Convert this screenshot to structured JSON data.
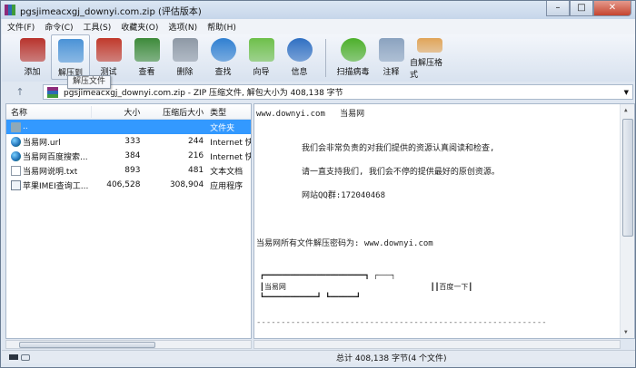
{
  "title": "pgsjimeacxgj_downyi.com.zip (评估版本)",
  "window_buttons": {
    "minimize": "–",
    "maximize": "□",
    "close": "✕"
  },
  "menu": [
    "文件(F)",
    "命令(C)",
    "工具(S)",
    "收藏夹(O)",
    "选项(N)",
    "帮助(H)"
  ],
  "toolbar": [
    {
      "label": "添加",
      "icon": "add-archive-icon",
      "color": "#b8332c"
    },
    {
      "label": "解压到",
      "icon": "extract-folder-icon",
      "color": "#4a92d6"
    },
    {
      "label": "测试",
      "icon": "test-checklist-icon",
      "color": "#c0392b"
    },
    {
      "label": "查看",
      "icon": "view-book-icon",
      "color": "#3d8a3a"
    },
    {
      "label": "删除",
      "icon": "trash-icon",
      "color": "#8d98a5"
    },
    {
      "label": "查找",
      "icon": "find-magnifier-icon",
      "color": "#2f7fd1"
    },
    {
      "label": "向导",
      "icon": "wizard-wand-icon",
      "color": "#6dbf4a"
    },
    {
      "label": "信息",
      "icon": "info-icon",
      "color": "#2f6fc2"
    },
    {
      "label": "扫描病毒",
      "icon": "virus-scan-icon",
      "color": "#4caf2a"
    },
    {
      "label": "注释",
      "icon": "comment-icon",
      "color": "#8aa2bf"
    },
    {
      "label": "自解压格式",
      "icon": "sfx-box-icon",
      "color": "#e0a458"
    }
  ],
  "tooltip": "解压文件",
  "address": {
    "text": "pgsjimeacxgj_downyi.com.zip - ZIP 压缩文件, 解包大小为 408,138 字节",
    "up": "↑"
  },
  "columns": [
    "名称",
    "大小",
    "压缩后大小",
    "类型"
  ],
  "files": [
    {
      "name": "..",
      "size": "",
      "packed": "",
      "type": "文件夹",
      "icon": "folder"
    },
    {
      "name": "当易网.url",
      "size": "333",
      "packed": "244",
      "type": "Internet 快",
      "icon": "globe"
    },
    {
      "name": "当易网百度搜索...",
      "size": "384",
      "packed": "216",
      "type": "Internet 快",
      "icon": "globe"
    },
    {
      "name": "当易网说明.txt",
      "size": "893",
      "packed": "481",
      "type": "文本文档",
      "icon": "txt"
    },
    {
      "name": "苹果IMEI查询工...",
      "size": "406,528",
      "packed": "308,904",
      "type": "应用程序",
      "icon": "exe"
    }
  ],
  "comment": [
    "www.downyi.com   当易网",
    "我们会非常负责的对我们提供的资源认真阅读和检查,",
    "请一直支持我们, 我们会不停的提供最好的原创资源。",
    "网站QQ群:172040468",
    "当易网所有文件解压密码为: www.downyi.com",
    "┏━━━━━━━━━━━━━━━━━━━━━━━┓ ┌───┐",
    "┃当易网                                 ┃┃百度一下┃",
    "┗━━━━━━━━━━━━┛ ┗━━━━━━┛",
    "-----------------------------------------------------------"
  ],
  "status": {
    "total": "总计 408,138 字节(4 个文件)"
  }
}
